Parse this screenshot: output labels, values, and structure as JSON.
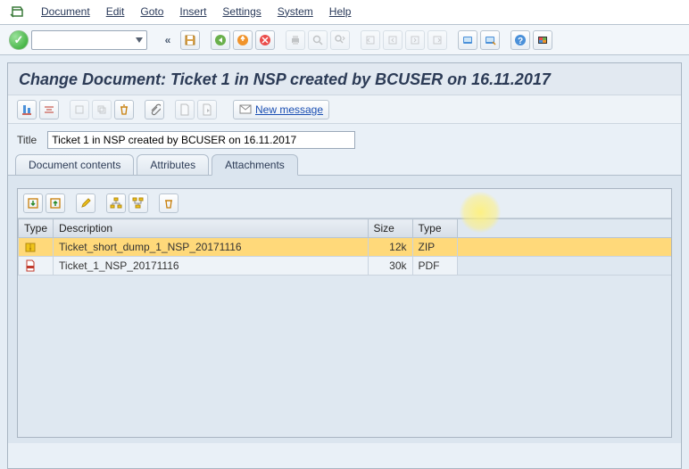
{
  "menu": {
    "items": [
      "Document",
      "Edit",
      "Goto",
      "Insert",
      "Settings",
      "System",
      "Help"
    ]
  },
  "page": {
    "title": "Change Document: Ticket 1 in NSP created by BCUSER on 16.11.2017"
  },
  "app_toolbar": {
    "new_message": "New message"
  },
  "title_field": {
    "label": "Title",
    "value": "Ticket 1 in NSP created by BCUSER on 16.11.2017"
  },
  "tabs": {
    "items": [
      "Document contents",
      "Attributes",
      "Attachments"
    ],
    "active": 2
  },
  "table": {
    "columns": [
      "Type",
      "Description",
      "Size",
      "Type"
    ],
    "rows": [
      {
        "icon": "zip",
        "description": "Ticket_short_dump_1_NSP_20171116",
        "size": "12k",
        "type": "ZIP",
        "selected": true
      },
      {
        "icon": "pdf",
        "description": "Ticket_1_NSP_20171116",
        "size": "30k",
        "type": "PDF",
        "selected": false
      }
    ]
  },
  "inner_toolbar_icons": [
    "import-icon",
    "export-icon",
    "edit-icon",
    "hierarchy-icon",
    "tree-icon",
    "delete-icon"
  ],
  "app_toolbar_icons": [
    "align-bottom-icon",
    "align-center-icon",
    "indent-icon",
    "list-icon",
    "delete-icon",
    "attach-icon",
    "page-icon",
    "page-next-icon"
  ],
  "std_toolbar_icons": [
    "back-icon",
    "exit-icon",
    "cancel-icon",
    "print-icon",
    "find-icon",
    "find-next-icon",
    "first-page-icon",
    "prev-page-icon",
    "next-page-icon",
    "last-page-icon",
    "new-session-icon",
    "shortcut-icon",
    "help-icon",
    "layout-icon"
  ]
}
